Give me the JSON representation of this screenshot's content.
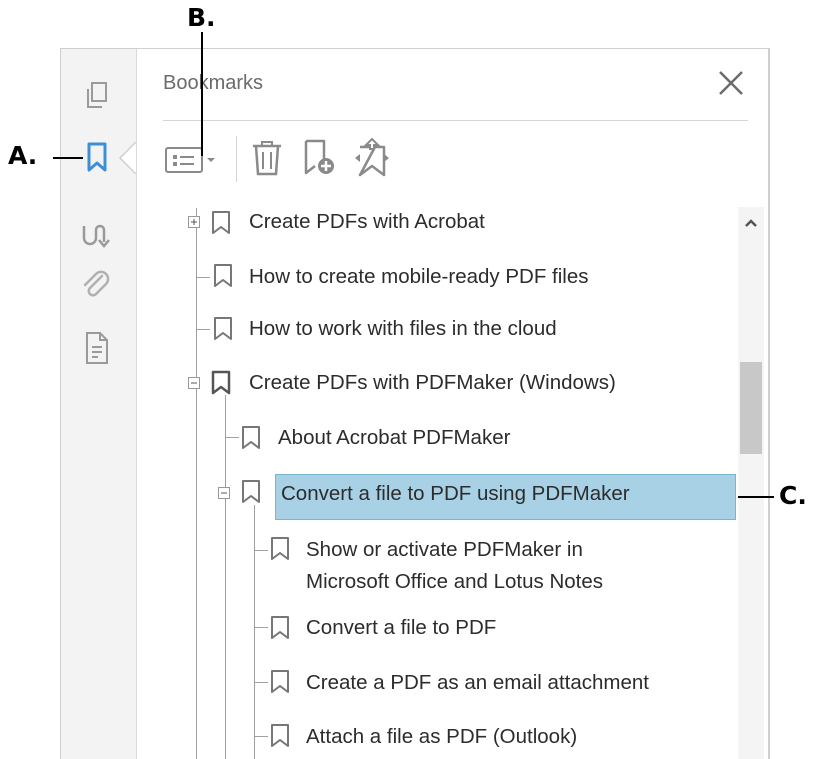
{
  "callouts": {
    "a": "A.",
    "b": "B.",
    "c": "C."
  },
  "panel": {
    "title": "Bookmarks",
    "close_glyph": "✕"
  },
  "toolbar": {
    "options_icon": "options-dropdown-icon",
    "delete_icon": "trash-icon",
    "new_bookmark_icon": "new-bookmark-icon",
    "expand_icon": "expand-bookmark-icon"
  },
  "rail_icons": [
    "page-thumbnails-icon",
    "bookmarks-icon",
    "signatures-icon",
    "attachments-icon",
    "document-icon"
  ],
  "bookmarks": [
    {
      "label": "Create PDFs with Acrobat"
    },
    {
      "label": "How to create mobile-ready PDF files"
    },
    {
      "label": "How to work with files in the cloud"
    },
    {
      "label": "Create PDFs with PDFMaker (Windows)"
    },
    {
      "label": "About Acrobat PDFMaker"
    },
    {
      "label": "Convert a file to PDF using PDFMaker"
    },
    {
      "label_line1": "Show or activate PDFMaker in",
      "label_line2": "Microsoft Office and Lotus Notes"
    },
    {
      "label": "Convert a file to PDF"
    },
    {
      "label": "Create a PDF as an email attachment"
    },
    {
      "label": "Attach a file as PDF (Outlook)"
    }
  ],
  "colors": {
    "accent": "#3b8fd9",
    "highlight": "#a8d1e6",
    "icon_gray": "#9a9a9a"
  }
}
